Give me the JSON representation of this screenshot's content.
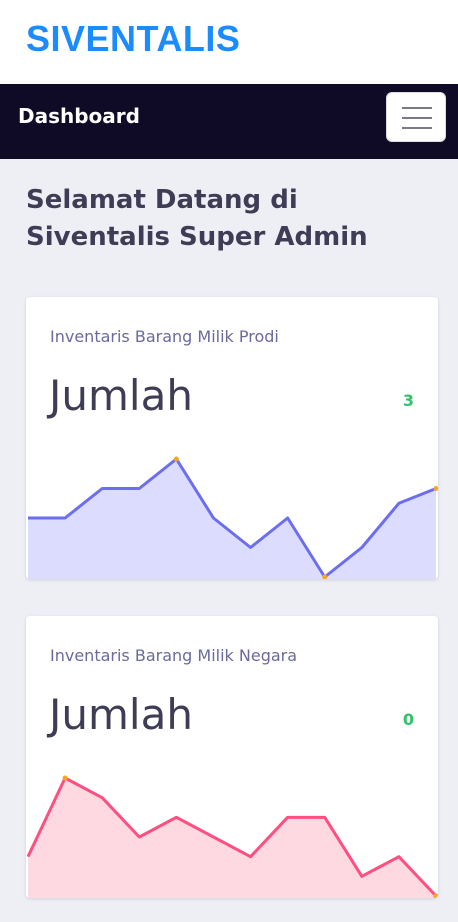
{
  "app": {
    "brand": "SIVENTALIS",
    "brand_color": "#1a8cff"
  },
  "nav": {
    "title": "Dashboard",
    "menu_icon": "hamburger-icon"
  },
  "welcome_text": "Selamat Datang di Siventalis Super Admin",
  "cards": [
    {
      "label": "Inventaris Barang Milik Prodi",
      "metric": "Jumlah",
      "value": "3",
      "line_color": "#6b6ef0",
      "fill_color": "#dcdcff",
      "spark": [
        3,
        3,
        5,
        5,
        7,
        3,
        1,
        3,
        -1,
        1,
        4,
        5
      ]
    },
    {
      "label": "Inventaris Barang Milik Negara",
      "metric": "Jumlah",
      "value": "0",
      "line_color": "#ff4f80",
      "fill_color": "#ffd9e2",
      "spark": [
        2,
        6,
        5,
        3,
        4,
        3,
        2,
        4,
        4,
        1,
        2,
        0
      ]
    }
  ]
}
